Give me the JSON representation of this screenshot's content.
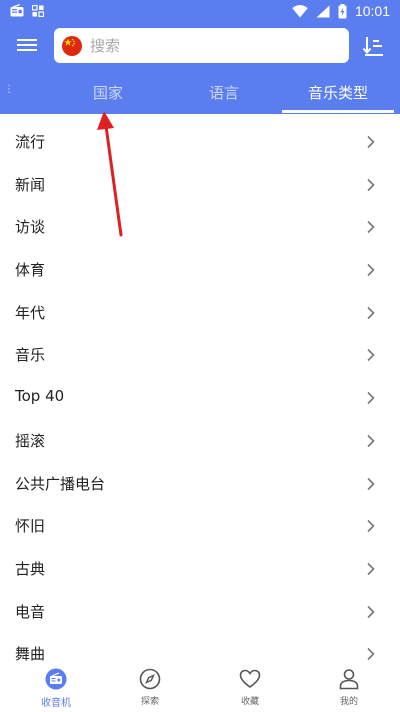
{
  "status_bar": {
    "time": "10:01"
  },
  "search": {
    "placeholder": "搜索",
    "value": ""
  },
  "tabs": [
    {
      "label": "国家",
      "active": false
    },
    {
      "label": "语言",
      "active": false
    },
    {
      "label": "音乐类型",
      "active": true
    }
  ],
  "genres": [
    {
      "label": "流行"
    },
    {
      "label": "新闻"
    },
    {
      "label": "访谈"
    },
    {
      "label": "体育"
    },
    {
      "label": "年代"
    },
    {
      "label": "音乐"
    },
    {
      "label": "Top 40"
    },
    {
      "label": "摇滚"
    },
    {
      "label": "公共广播电台"
    },
    {
      "label": "怀旧"
    },
    {
      "label": "古典"
    },
    {
      "label": "电音"
    },
    {
      "label": "舞曲"
    }
  ],
  "bottom_nav": [
    {
      "label": "收音机",
      "icon": "radio-icon",
      "active": true
    },
    {
      "label": "探索",
      "icon": "compass-icon",
      "active": false
    },
    {
      "label": "收藏",
      "icon": "heart-icon",
      "active": false
    },
    {
      "label": "我的",
      "icon": "person-icon",
      "active": false
    }
  ],
  "colors": {
    "header": "#5a7ef0",
    "accent": "#5a7ef0",
    "annotation_arrow": "#e02020",
    "flag_red": "#de2910",
    "flag_star": "#ffde00"
  }
}
